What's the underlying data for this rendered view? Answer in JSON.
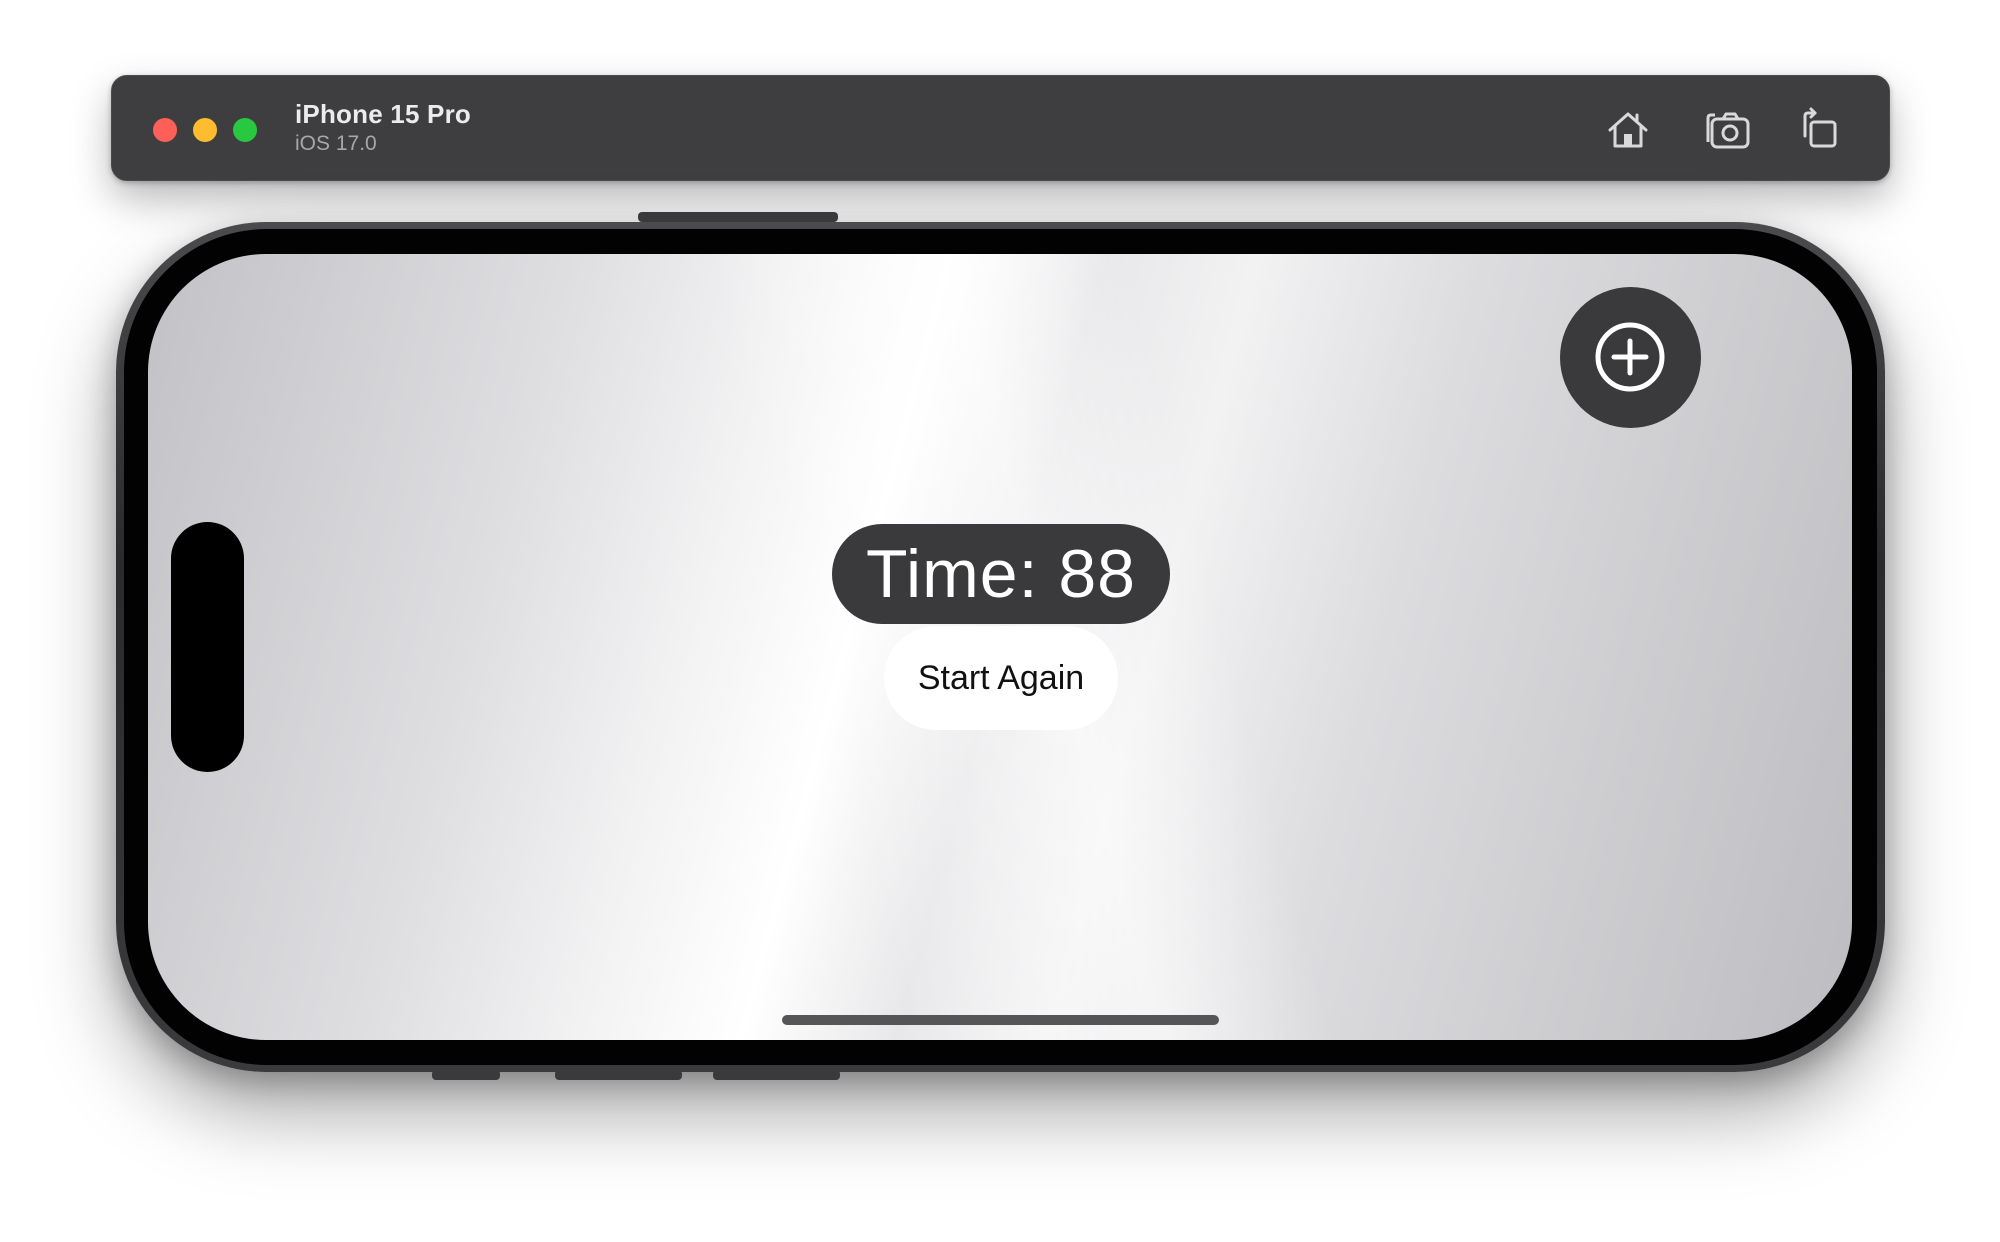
{
  "window": {
    "device_name": "iPhone 15 Pro",
    "os_version": "iOS 17.0"
  },
  "toolbar": {
    "icons": [
      "home-icon",
      "screenshot-icon",
      "rotate-icon"
    ]
  },
  "app": {
    "add_icon": "plus-circle-icon",
    "time_label": "Time: 88",
    "start_again_label": "Start Again"
  },
  "colors": {
    "titlebar": "#3e3e41",
    "close": "#fe5f57",
    "minimize": "#febc2e",
    "zoom": "#28c840",
    "pill": "#3a3a3c",
    "button": "#ffffff"
  }
}
